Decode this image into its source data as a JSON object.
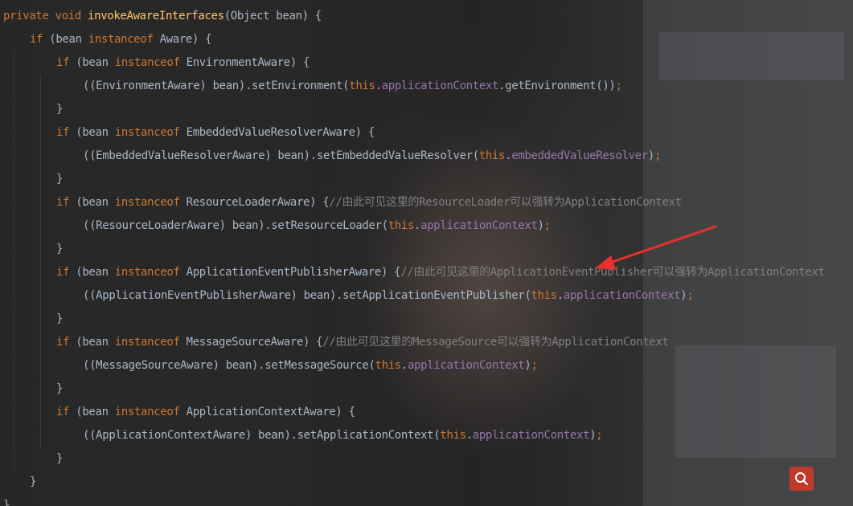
{
  "colors": {
    "keyword": "#cc7832",
    "method": "#ffc66d",
    "plain": "#a9b7c6",
    "field": "#9876aa",
    "comment": "#808080",
    "annotation_arrow": "#e8312f",
    "search_button": "#c0392b"
  },
  "icons": {
    "search": "magnifier-icon"
  },
  "lines": [
    {
      "indent": 0,
      "tokens": [
        [
          "kw",
          "private void "
        ],
        [
          "name",
          "invokeAwareInterfaces"
        ],
        [
          "plain",
          "(Object bean) {"
        ]
      ]
    },
    {
      "indent": 1,
      "tokens": [
        [
          "kw",
          "if "
        ],
        [
          "plain",
          "(bean "
        ],
        [
          "kw",
          "instanceof "
        ],
        [
          "plain",
          "Aware) {"
        ]
      ]
    },
    {
      "indent": 2,
      "tokens": [
        [
          "kw",
          "if "
        ],
        [
          "plain",
          "(bean "
        ],
        [
          "kw",
          "instanceof "
        ],
        [
          "plain",
          "EnvironmentAware) {"
        ]
      ]
    },
    {
      "indent": 3,
      "tokens": [
        [
          "plain",
          "((EnvironmentAware) bean).setEnvironment("
        ],
        [
          "kw",
          "this"
        ],
        [
          "plain",
          "."
        ],
        [
          "field",
          "applicationContext"
        ],
        [
          "plain",
          ".getEnvironment())"
        ],
        [
          "kw",
          ";"
        ]
      ]
    },
    {
      "indent": 2,
      "tokens": [
        [
          "plain",
          "}"
        ]
      ]
    },
    {
      "indent": 2,
      "tokens": [
        [
          "kw",
          "if "
        ],
        [
          "plain",
          "(bean "
        ],
        [
          "kw",
          "instanceof "
        ],
        [
          "plain",
          "EmbeddedValueResolverAware) {"
        ]
      ]
    },
    {
      "indent": 3,
      "tokens": [
        [
          "plain",
          "((EmbeddedValueResolverAware) bean).setEmbeddedValueResolver("
        ],
        [
          "kw",
          "this"
        ],
        [
          "plain",
          "."
        ],
        [
          "field",
          "embeddedValueResolver"
        ],
        [
          "plain",
          ")"
        ],
        [
          "kw",
          ";"
        ]
      ]
    },
    {
      "indent": 2,
      "tokens": [
        [
          "plain",
          "}"
        ]
      ]
    },
    {
      "indent": 2,
      "tokens": [
        [
          "kw",
          "if "
        ],
        [
          "plain",
          "(bean "
        ],
        [
          "kw",
          "instanceof "
        ],
        [
          "plain",
          "ResourceLoaderAware) {"
        ],
        [
          "cmt",
          "//由此可见这里的ResourceLoader可以强转为ApplicationContext"
        ]
      ]
    },
    {
      "indent": 3,
      "tokens": [
        [
          "plain",
          "((ResourceLoaderAware) bean).setResourceLoader("
        ],
        [
          "kw",
          "this"
        ],
        [
          "plain",
          "."
        ],
        [
          "field",
          "applicationContext"
        ],
        [
          "plain",
          ")"
        ],
        [
          "kw",
          ";"
        ]
      ]
    },
    {
      "indent": 2,
      "tokens": [
        [
          "plain",
          "}"
        ]
      ]
    },
    {
      "indent": 2,
      "tokens": [
        [
          "kw",
          "if "
        ],
        [
          "plain",
          "(bean "
        ],
        [
          "kw",
          "instanceof "
        ],
        [
          "plain",
          "ApplicationEventPublisherAware) {"
        ],
        [
          "cmt",
          "//由此可见这里的ApplicationEventPublisher可以强转为ApplicationContext"
        ]
      ]
    },
    {
      "indent": 3,
      "tokens": [
        [
          "plain",
          "((ApplicationEventPublisherAware) bean).setApplicationEventPublisher("
        ],
        [
          "kw",
          "this"
        ],
        [
          "plain",
          "."
        ],
        [
          "field",
          "applicationContext"
        ],
        [
          "plain",
          ")"
        ],
        [
          "kw",
          ";"
        ]
      ]
    },
    {
      "indent": 2,
      "tokens": [
        [
          "plain",
          "}"
        ]
      ]
    },
    {
      "indent": 2,
      "tokens": [
        [
          "kw",
          "if "
        ],
        [
          "plain",
          "(bean "
        ],
        [
          "kw",
          "instanceof "
        ],
        [
          "plain",
          "MessageSourceAware) {"
        ],
        [
          "cmt",
          "//由此可见这里的MessageSource可以强转为ApplicationContext"
        ]
      ]
    },
    {
      "indent": 3,
      "tokens": [
        [
          "plain",
          "((MessageSourceAware) bean).setMessageSource("
        ],
        [
          "kw",
          "this"
        ],
        [
          "plain",
          "."
        ],
        [
          "field",
          "applicationContext"
        ],
        [
          "plain",
          ")"
        ],
        [
          "kw",
          ";"
        ]
      ]
    },
    {
      "indent": 2,
      "tokens": [
        [
          "plain",
          "}"
        ]
      ]
    },
    {
      "indent": 2,
      "tokens": [
        [
          "kw",
          "if "
        ],
        [
          "plain",
          "(bean "
        ],
        [
          "kw",
          "instanceof "
        ],
        [
          "plain",
          "ApplicationContextAware) {"
        ]
      ]
    },
    {
      "indent": 3,
      "tokens": [
        [
          "plain",
          "((ApplicationContextAware) bean).setApplicationContext("
        ],
        [
          "kw",
          "this"
        ],
        [
          "plain",
          "."
        ],
        [
          "field",
          "applicationContext"
        ],
        [
          "plain",
          ")"
        ],
        [
          "kw",
          ";"
        ]
      ]
    },
    {
      "indent": 2,
      "tokens": [
        [
          "plain",
          "}"
        ]
      ]
    },
    {
      "indent": 1,
      "tokens": [
        [
          "plain",
          "}"
        ]
      ]
    },
    {
      "indent": 0,
      "tokens": [
        [
          "plain",
          "}"
        ]
      ]
    }
  ]
}
